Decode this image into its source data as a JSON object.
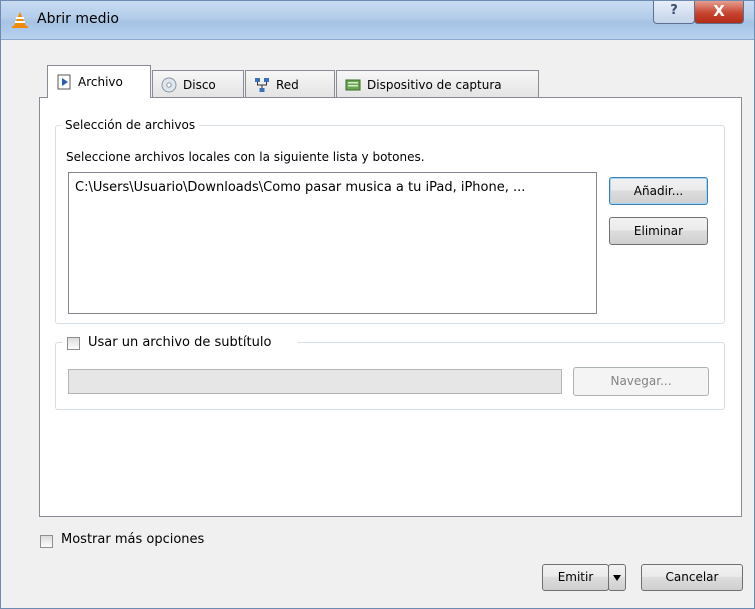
{
  "window": {
    "title": "Abrir medio",
    "help_icon": "?",
    "close_icon": "X"
  },
  "tabs": [
    {
      "label": "Archivo",
      "icon": "file-play-icon",
      "active": true
    },
    {
      "label": "Disco",
      "icon": "disc-icon",
      "active": false
    },
    {
      "label": "Red",
      "icon": "network-icon",
      "active": false
    },
    {
      "label": "Dispositivo de captura",
      "icon": "capture-device-icon",
      "active": false
    }
  ],
  "file_selection": {
    "legend": "Selección de archivos",
    "description": "Seleccione archivos locales con la siguiente lista y botones.",
    "files": [
      "C:\\Users\\Usuario\\Downloads\\Como pasar musica a tu iPad, iPhone, ..."
    ],
    "add_label": "Añadir...",
    "remove_label": "Eliminar"
  },
  "subtitle": {
    "checkbox_label": "Usar un archivo de subtítulo",
    "checked": false,
    "path_value": "",
    "browse_label": "Navegar..."
  },
  "footer": {
    "more_options_label": "Mostrar más opciones",
    "more_options_checked": false,
    "emit_label": "Emitir",
    "cancel_label": "Cancelar"
  },
  "colors": {
    "titlebar": "#b3cde9",
    "close_button": "#c7442f",
    "default_button_border": "#3c7fb1"
  }
}
